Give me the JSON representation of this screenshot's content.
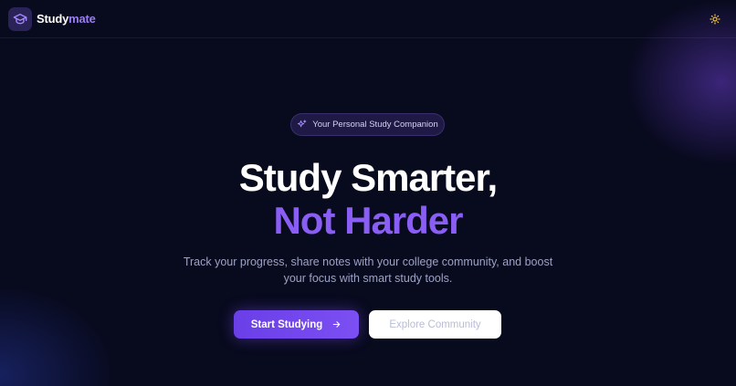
{
  "header": {
    "brand_part1": "Study",
    "brand_part2": "mate",
    "logo_icon": "graduation-cap-icon",
    "theme_icon": "sun-icon"
  },
  "hero": {
    "badge": {
      "icon": "sparkles-icon",
      "text": "Your Personal Study Companion"
    },
    "title_line1": "Study Smarter,",
    "title_line2": "Not Harder",
    "subtitle_line1": "Track your progress, share notes with your college community, and boost",
    "subtitle_line2": "your focus with smart study tools.",
    "primary_button": {
      "label": "Start Studying",
      "icon": "arrow-right-icon"
    },
    "secondary_button": {
      "label": "Explore Community"
    }
  },
  "colors": {
    "background": "#080a1e",
    "accent": "#8a5ef5",
    "button_primary": "#7b4ff2",
    "theme_icon": "#f5c542"
  }
}
